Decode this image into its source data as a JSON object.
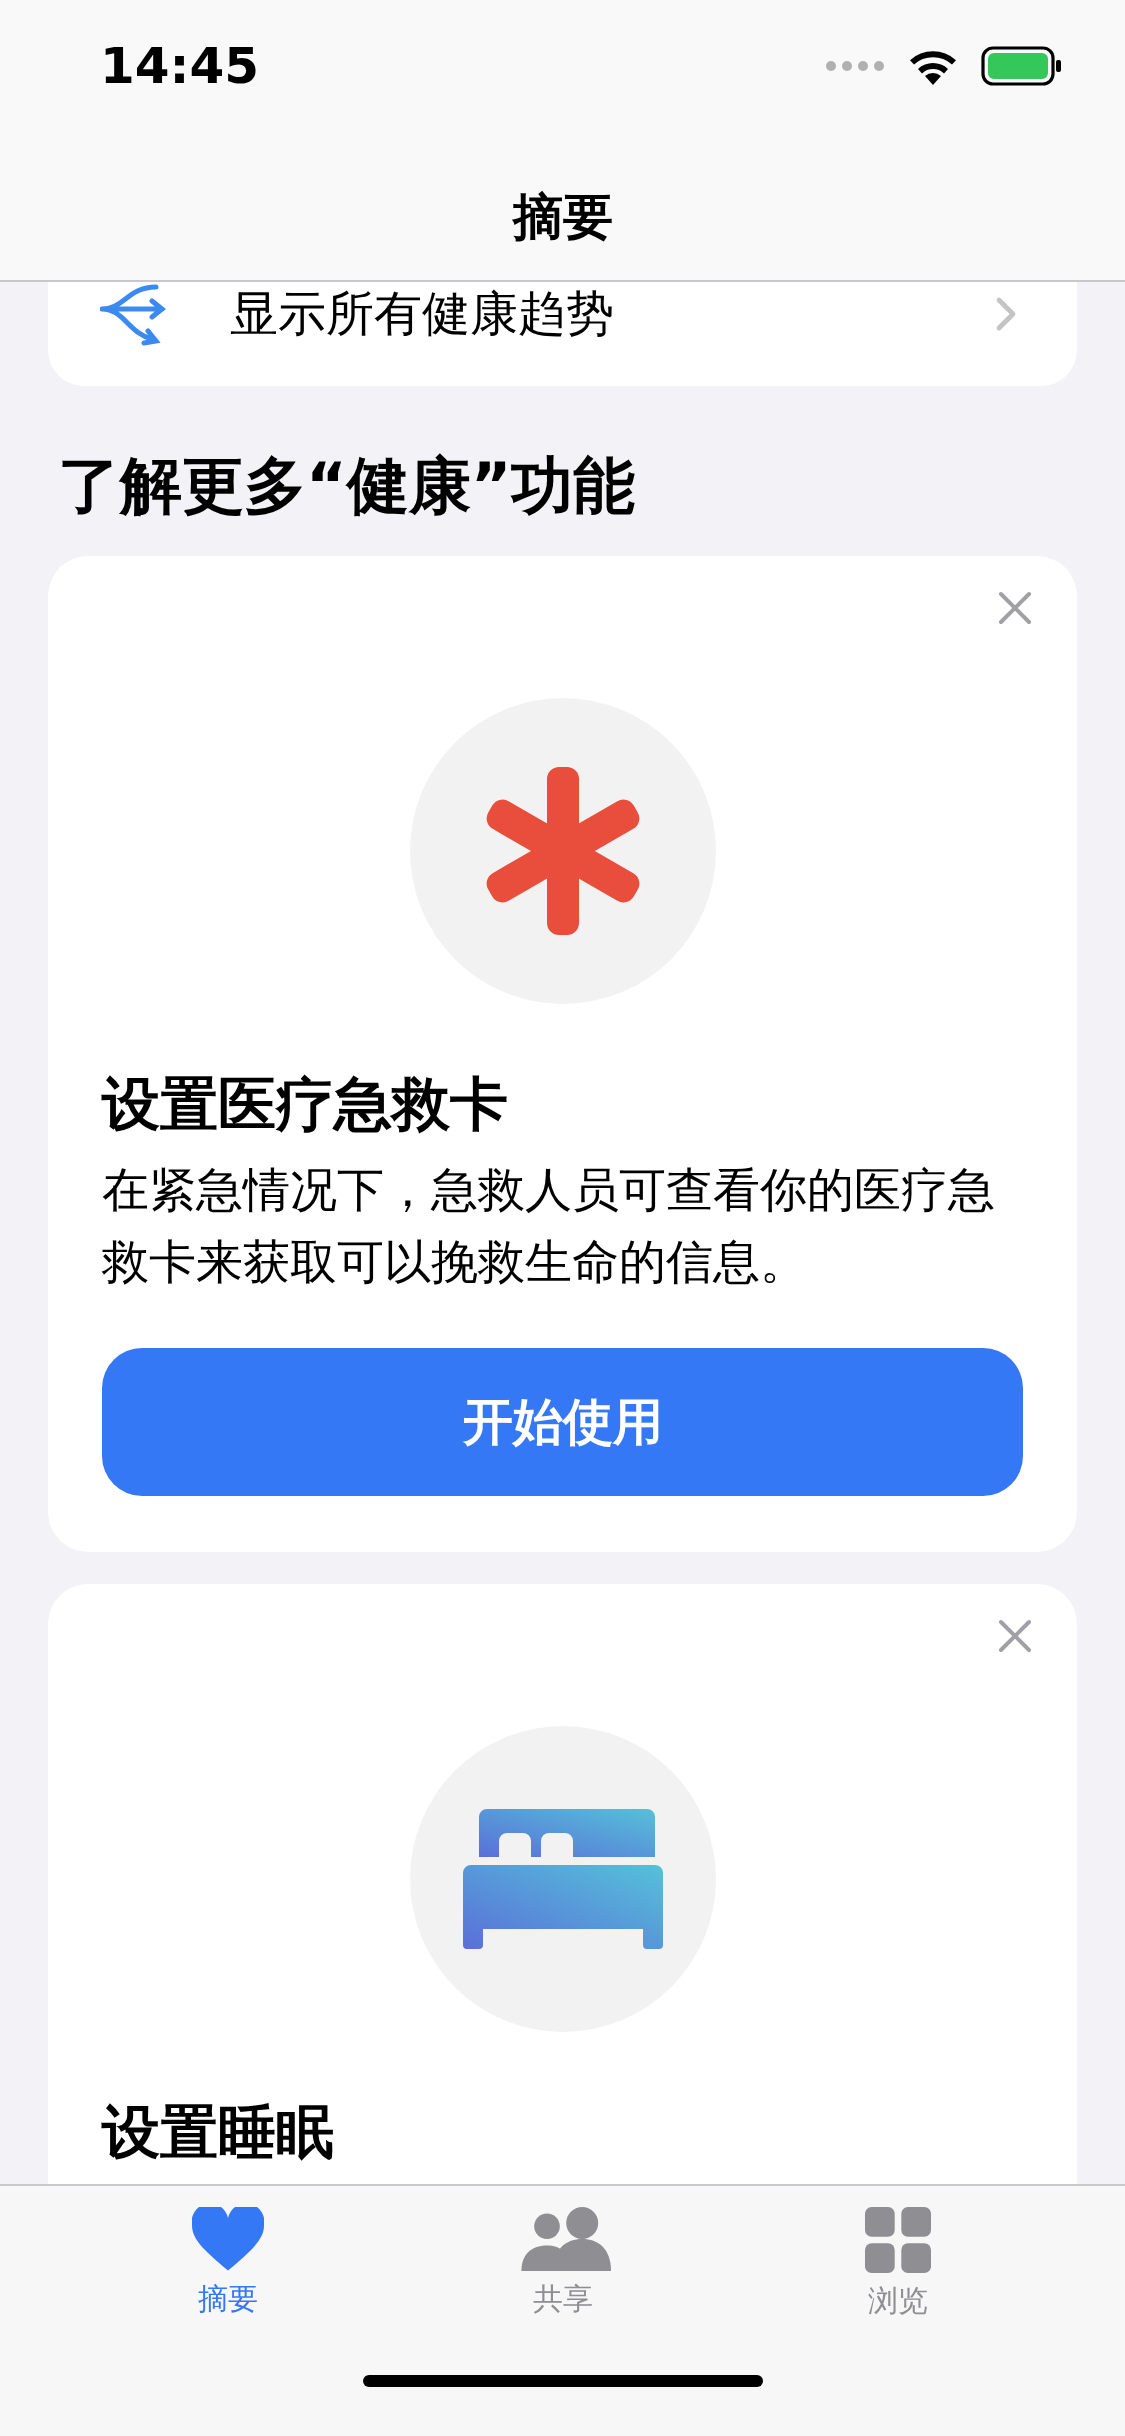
{
  "status_bar": {
    "time": "14:45"
  },
  "nav": {
    "title": "摘要"
  },
  "trends_row": {
    "label": "显示所有健康趋势"
  },
  "section": {
    "title": "了解更多“健康”功能"
  },
  "feature_cards": [
    {
      "kind": "medical",
      "title": "设置医疗急救卡",
      "body": "在紧急情况下，急救人员可查看你的医疗急救卡来获取可以挽救生命的信息。",
      "button": "开始使用"
    },
    {
      "kind": "sleep",
      "title": "设置睡眠"
    }
  ],
  "tabs": [
    {
      "kind": "heart",
      "label": "摘要",
      "selected": true
    },
    {
      "kind": "people",
      "label": "共享",
      "selected": false
    },
    {
      "kind": "grid",
      "label": "浏览",
      "selected": false
    }
  ]
}
